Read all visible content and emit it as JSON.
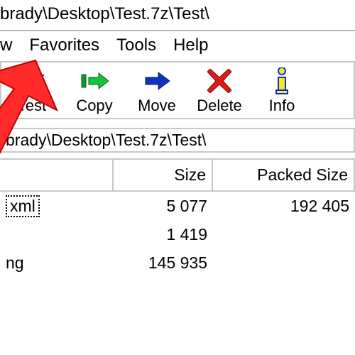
{
  "title": "brady\\Desktop\\Test.7z\\Test\\",
  "menu": {
    "view": "w",
    "favorites": "Favorites",
    "tools": "Tools",
    "help": "Help"
  },
  "toolbar": {
    "test": "Test",
    "copy": "Copy",
    "move": "Move",
    "delete": "Delete",
    "info": "Info"
  },
  "path": "brady\\Desktop\\Test.7z\\Test\\",
  "columns": {
    "name": "",
    "size": "Size",
    "packed": "Packed Size"
  },
  "rows": [
    {
      "name": "xml",
      "size": "5 077",
      "packed": "192 405",
      "selected": true
    },
    {
      "name": "",
      "size": "1 419",
      "packed": ""
    },
    {
      "name": "ng",
      "size": "145 935",
      "packed": ""
    }
  ]
}
